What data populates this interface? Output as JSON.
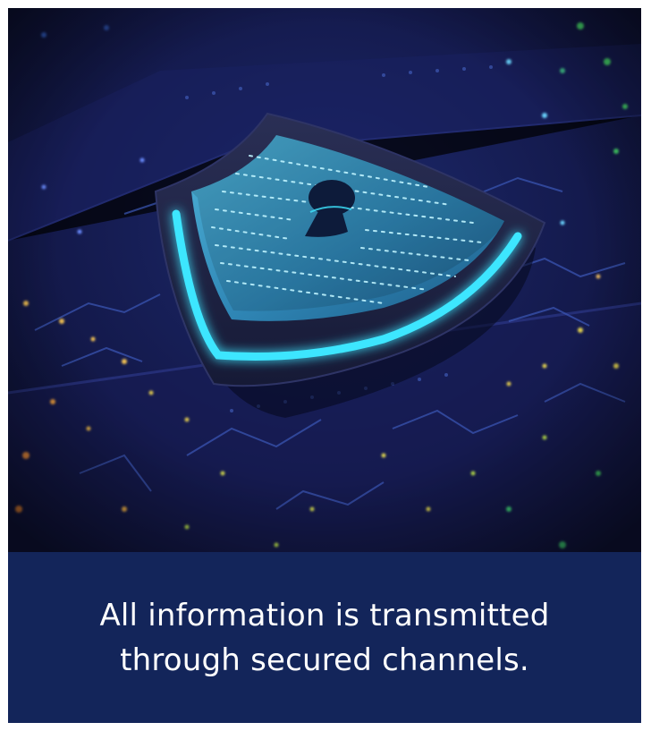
{
  "image": {
    "subject": "shield-with-keyhole-on-circuit-board"
  },
  "caption": {
    "text": "All information is transmitted through secured channels."
  },
  "colors": {
    "caption_background": "#13255a",
    "caption_text": "#ffffff",
    "glow_accent": "#3ee6ff",
    "scene_background": "#0d1238"
  }
}
